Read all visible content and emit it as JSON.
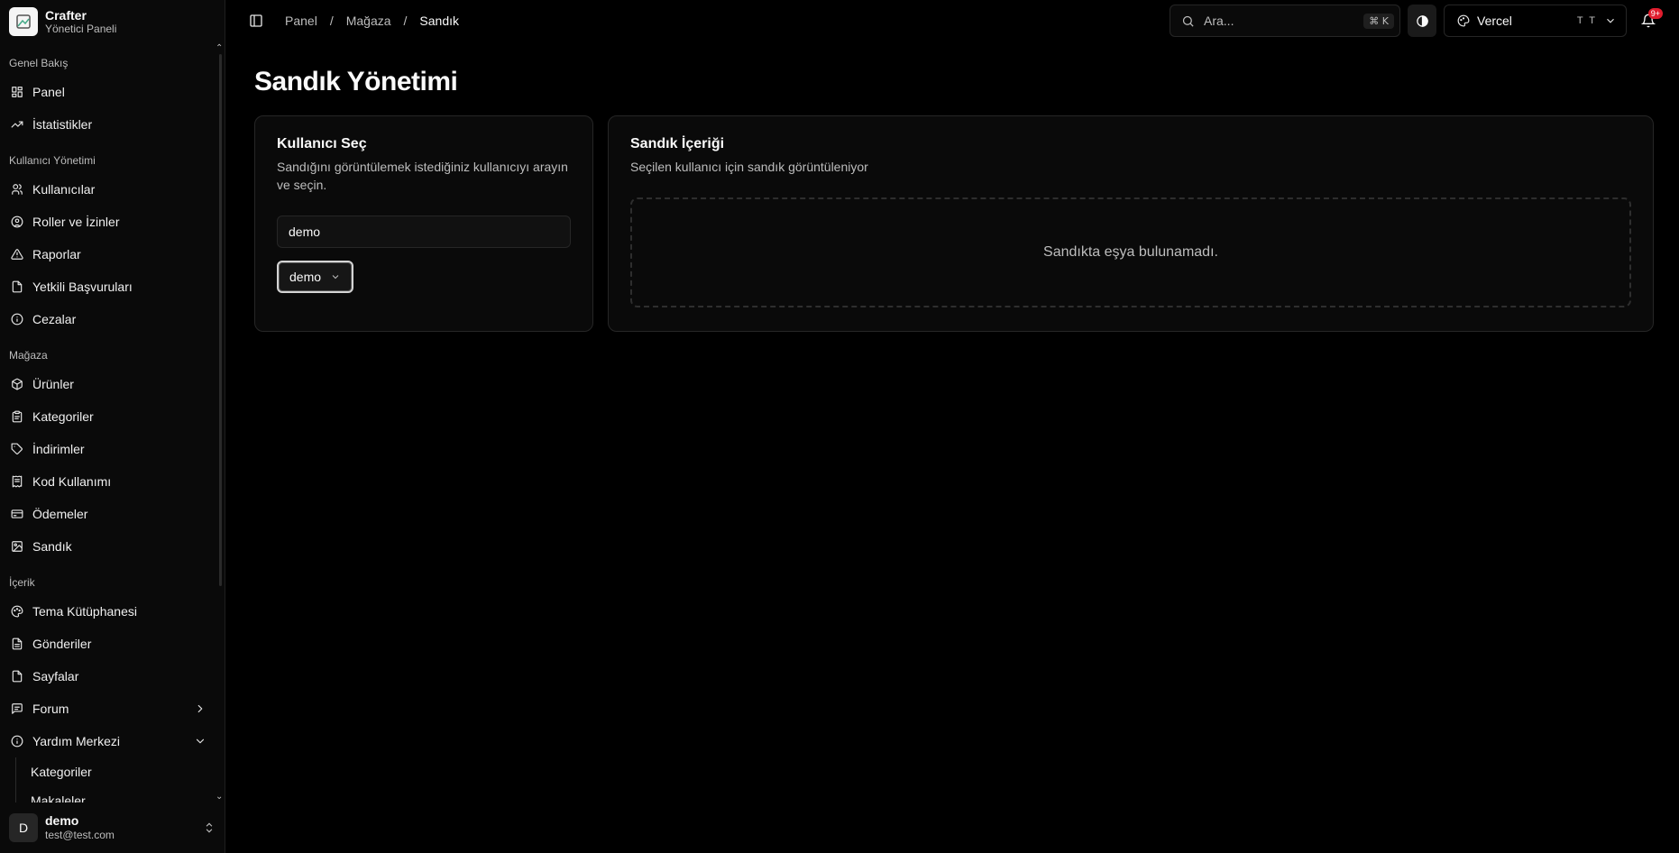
{
  "brand": {
    "name": "Crafter",
    "subtitle": "Yönetici Paneli"
  },
  "sidebar": {
    "groups": [
      {
        "label": "Genel Bakış",
        "items": [
          {
            "label": "Panel",
            "icon": "layout-grid-icon"
          },
          {
            "label": "İstatistikler",
            "icon": "trending-up-icon"
          }
        ]
      },
      {
        "label": "Kullanıcı Yönetimi",
        "items": [
          {
            "label": "Kullanıcılar",
            "icon": "users-icon"
          },
          {
            "label": "Roller ve İzinler",
            "icon": "user-circle-icon"
          },
          {
            "label": "Raporlar",
            "icon": "warning-triangle-icon"
          },
          {
            "label": "Yetkili Başvuruları",
            "icon": "file-icon"
          },
          {
            "label": "Cezalar",
            "icon": "info-circle-icon"
          }
        ]
      },
      {
        "label": "Mağaza",
        "items": [
          {
            "label": "Ürünler",
            "icon": "box-icon"
          },
          {
            "label": "Kategoriler",
            "icon": "clipboard-icon"
          },
          {
            "label": "İndirimler",
            "icon": "tag-icon"
          },
          {
            "label": "Kod Kullanımı",
            "icon": "receipt-icon"
          },
          {
            "label": "Ödemeler",
            "icon": "credit-card-icon"
          },
          {
            "label": "Sandık",
            "icon": "image-icon"
          }
        ]
      },
      {
        "label": "İçerik",
        "items": [
          {
            "label": "Tema Kütüphanesi",
            "icon": "palette-icon"
          },
          {
            "label": "Gönderiler",
            "icon": "file-text-icon"
          },
          {
            "label": "Sayfalar",
            "icon": "file-icon"
          },
          {
            "label": "Forum",
            "icon": "message-icon"
          },
          {
            "label": "Yardım Merkezi",
            "icon": "info-circle-icon"
          }
        ]
      }
    ],
    "help_sub_items": [
      "Kategoriler",
      "Makaleler"
    ]
  },
  "user": {
    "initial": "D",
    "name": "demo",
    "email": "test@test.com"
  },
  "breadcrumb": {
    "items": [
      "Panel",
      "Mağaza"
    ],
    "current": "Sandık",
    "separator": "/"
  },
  "search": {
    "placeholder": "Ara...",
    "shortcut": "⌘ K"
  },
  "theme": {
    "name": "Vercel",
    "badge": "T T"
  },
  "notifications": {
    "badge": "9+"
  },
  "page": {
    "title": "Sandık Yönetimi"
  },
  "user_select_card": {
    "title": "Kullanıcı Seç",
    "description": "Sandığını görüntülemek istediğiniz kullanıcıyı arayın ve seçin.",
    "input_value": "demo",
    "selected_user": "demo"
  },
  "chest_card": {
    "title": "Sandık İçeriği",
    "description": "Seçilen kullanıcı için sandık görüntüleniyor",
    "empty_message": "Sandıkta eşya bulunamadı."
  },
  "colors": {
    "background": "#000000",
    "panel": "#0a0a0a",
    "border": "#262626",
    "badge": "#e11d2e"
  }
}
